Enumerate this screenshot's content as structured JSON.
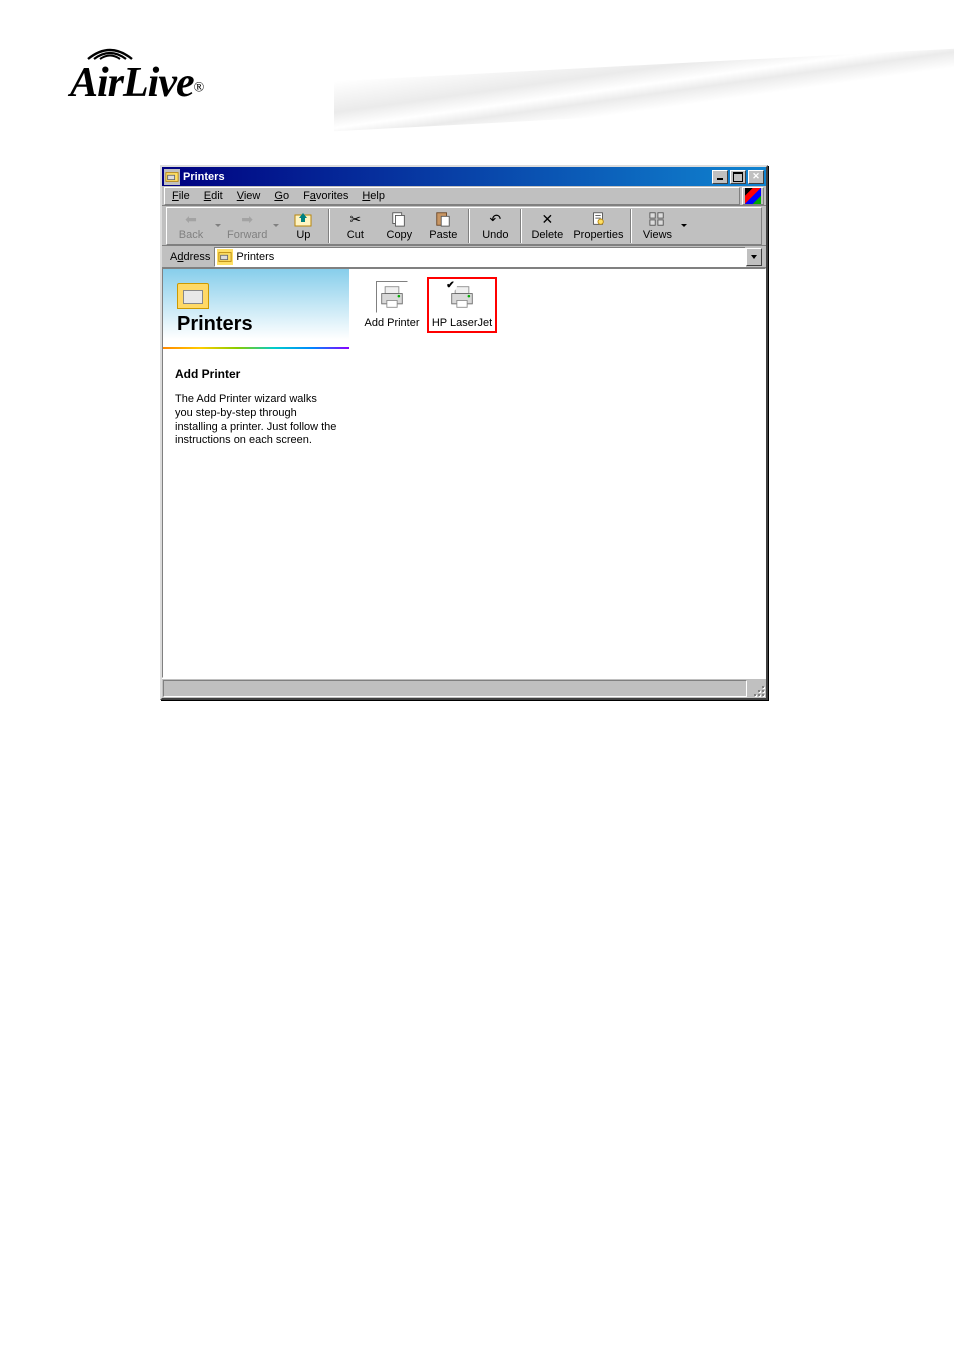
{
  "logo": {
    "text": "AirLive",
    "reg": "®"
  },
  "window": {
    "title": "Printers",
    "menu": {
      "file": "File",
      "edit": "Edit",
      "view": "View",
      "go": "Go",
      "favorites": "Favorites",
      "help": "Help"
    },
    "toolbar": {
      "back": "Back",
      "forward": "Forward",
      "up": "Up",
      "cut": "Cut",
      "copy": "Copy",
      "paste": "Paste",
      "undo": "Undo",
      "delete": "Delete",
      "properties": "Properties",
      "views": "Views"
    },
    "address": {
      "label": "Address",
      "value": "Printers"
    },
    "sidebar": {
      "title": "Printers",
      "heading": "Add Printer",
      "description": "The Add Printer wizard walks you step-by-step through installing a printer. Just follow the instructions on each screen."
    },
    "items": [
      {
        "label": "Add Printer",
        "type": "wizard"
      },
      {
        "label": "HP LaserJet",
        "type": "printer",
        "default": true,
        "highlighted": true
      }
    ]
  }
}
